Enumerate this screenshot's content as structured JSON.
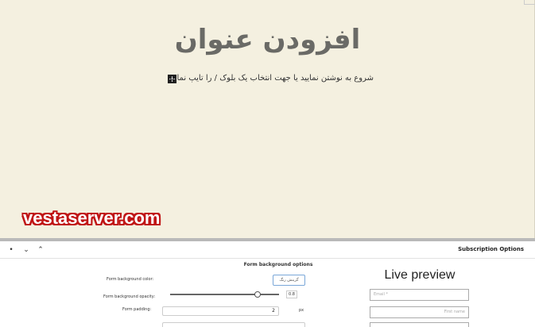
{
  "editor": {
    "post_title": "افزودن عنوان",
    "placeholder": "شروع به نوشتن نمایید یا جهت انتخاب یک بلوک / را تایپ نمایید",
    "add_block_glyph": "+"
  },
  "watermark": {
    "text": "vestaserver.com"
  },
  "panel": {
    "title": "Subscription Options",
    "controls": {
      "toggle": "•",
      "down": "⌄",
      "up": "⌃"
    },
    "section_title": "Form background options",
    "fields": {
      "bg_color_label": "Form background color:",
      "bg_color_value": "گزینش رنگ",
      "bg_opacity_label": "Form background opacity:",
      "bg_opacity_value": "0.8",
      "bg_opacity_fraction": 0.8,
      "padding_label": "Form padding:",
      "padding_value": "2",
      "padding_unit": "px"
    },
    "preview": {
      "title": "Live preview",
      "email_placeholder": "Email *",
      "firstname_placeholder": "First name"
    }
  }
}
